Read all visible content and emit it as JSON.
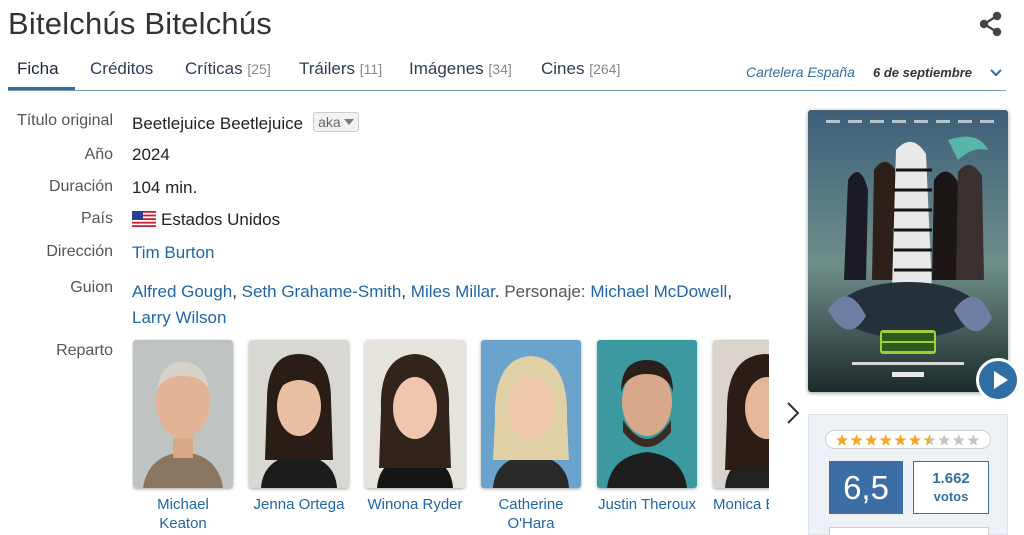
{
  "movie": {
    "title": "Bitelchús Bitelchús"
  },
  "tabs": [
    {
      "label": "Ficha",
      "count": ""
    },
    {
      "label": "Créditos",
      "count": ""
    },
    {
      "label": "Críticas",
      "count": "[25]"
    },
    {
      "label": "Tráilers",
      "count": "[11]"
    },
    {
      "label": "Imágenes",
      "count": "[34]"
    },
    {
      "label": "Cines",
      "count": "[264]"
    }
  ],
  "release": {
    "label": "Cartelera España",
    "date": "6 de septiembre"
  },
  "info": {
    "titulo_original": {
      "label": "Título original",
      "value": "Beetlejuice Beetlejuice",
      "aka": "aka"
    },
    "anio": {
      "label": "Año",
      "value": "2024"
    },
    "duracion": {
      "label": "Duración",
      "value": "104 min."
    },
    "pais": {
      "label": "País",
      "value": "Estados Unidos"
    },
    "direccion": {
      "label": "Dirección",
      "value": "Tim Burton"
    },
    "guion": {
      "label": "Guion",
      "writers": [
        "Alfred Gough",
        "Seth Grahame-Smith",
        "Miles Millar"
      ],
      "personaje_label": "Personaje:",
      "characters": [
        "Michael McDowell",
        "Larry Wilson"
      ]
    },
    "reparto": {
      "label": "Reparto"
    }
  },
  "cast": [
    {
      "name": "Michael Keaton"
    },
    {
      "name": "Jenna Ortega"
    },
    {
      "name": "Winona Ryder"
    },
    {
      "name": "Catherine O'Hara"
    },
    {
      "name": "Justin Theroux"
    },
    {
      "name": "Monica Bellucci"
    }
  ],
  "rating": {
    "score": "6,5",
    "votes": "1.662",
    "votes_label": "votos",
    "stars_filled": 6.5,
    "stars_total": 10
  },
  "colors": {
    "accent": "#2f6fa3",
    "link": "#1f66a8",
    "score_bg": "#3b6ea5",
    "star": "#f5a623"
  }
}
